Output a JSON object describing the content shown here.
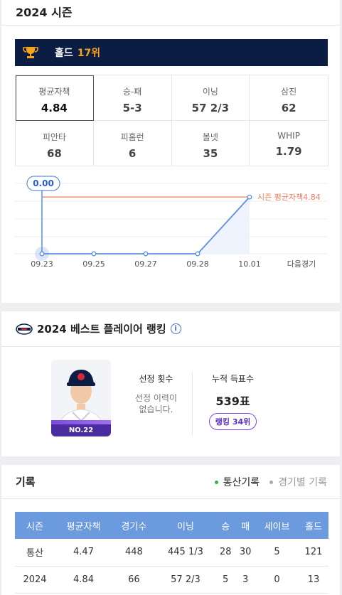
{
  "season": {
    "title": "2024 시즌",
    "hold_label": "홀드",
    "hold_rank": "17위",
    "stats": [
      {
        "label": "평균자책",
        "value": "4.84"
      },
      {
        "label": "승-패",
        "value": "5-3"
      },
      {
        "label": "이닝",
        "value": "57 2/3"
      },
      {
        "label": "삼진",
        "value": "62"
      },
      {
        "label": "피안타",
        "value": "68"
      },
      {
        "label": "피홈런",
        "value": "6"
      },
      {
        "label": "볼넷",
        "value": "35"
      },
      {
        "label": "WHIP",
        "value": "1.79"
      }
    ]
  },
  "chart_data": {
    "type": "line",
    "x": [
      "09.23",
      "09.25",
      "09.27",
      "09.28",
      "10.01"
    ],
    "values": [
      0.0,
      0.0,
      0.0,
      0.0,
      4.84
    ],
    "next_game_label": "다음경기",
    "highlight_label": "0.00",
    "reference_line": {
      "value": 4.84,
      "label": "시즌 평균자책4.84"
    },
    "ylim": [
      0,
      6
    ],
    "colors": {
      "line": "#5d8fe0",
      "fill": "#eef3fd",
      "reference": "#f07c5c"
    }
  },
  "ranking": {
    "title": "2024 베스트 플레이어 랭킹",
    "player_number": "NO.22",
    "selection_title": "선정 횟수",
    "selection_desc_line1": "선정 이력이",
    "selection_desc_line2": "없습니다.",
    "vote_title": "누적 득표수",
    "vote_value": "539표",
    "rank_badge": "랭킹 34위"
  },
  "record": {
    "title": "기록",
    "tabs": [
      {
        "label": "통산기록",
        "active": true
      },
      {
        "label": "경기별 기록",
        "active": false
      }
    ],
    "columns": [
      "시즌",
      "평균자책",
      "경기수",
      "이닝",
      "승",
      "패",
      "세이브",
      "홀드"
    ],
    "rows": [
      [
        "통산",
        "4.47",
        "448",
        "445 1/3",
        "28",
        "30",
        "5",
        "121"
      ],
      [
        "2024",
        "4.84",
        "66",
        "57 2/3",
        "5",
        "3",
        "0",
        "13"
      ]
    ]
  },
  "colors": {
    "banner_bg": "#0b1d42",
    "rank_accent": "#f7a21b",
    "table_header": "#6b9bde",
    "badge_purple": "#4a2ca0"
  }
}
